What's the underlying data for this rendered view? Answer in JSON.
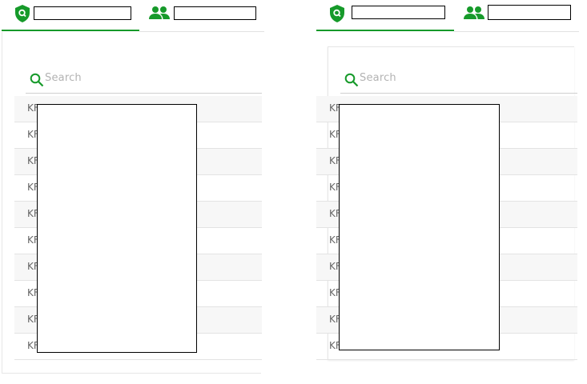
{
  "panels": [
    {
      "search": {
        "placeholder": "Search"
      },
      "rows": [
        "KF",
        "KF",
        "KF",
        "KF",
        "KF",
        "KF",
        "KF",
        "KF",
        "KF",
        "KF"
      ]
    },
    {
      "search": {
        "placeholder": "Search"
      },
      "rows": [
        "KF",
        "KF",
        "KF",
        "KF",
        "KF",
        "KF",
        "KF",
        "KF",
        "KF",
        "KF"
      ]
    }
  ],
  "colors": {
    "accent": "#169a2a",
    "row_alt": "#f7f7f7",
    "divider": "#e3e3e3"
  },
  "icons": {
    "tab1": "shield-search-icon",
    "tab2": "people-icon",
    "search": "search-icon"
  }
}
